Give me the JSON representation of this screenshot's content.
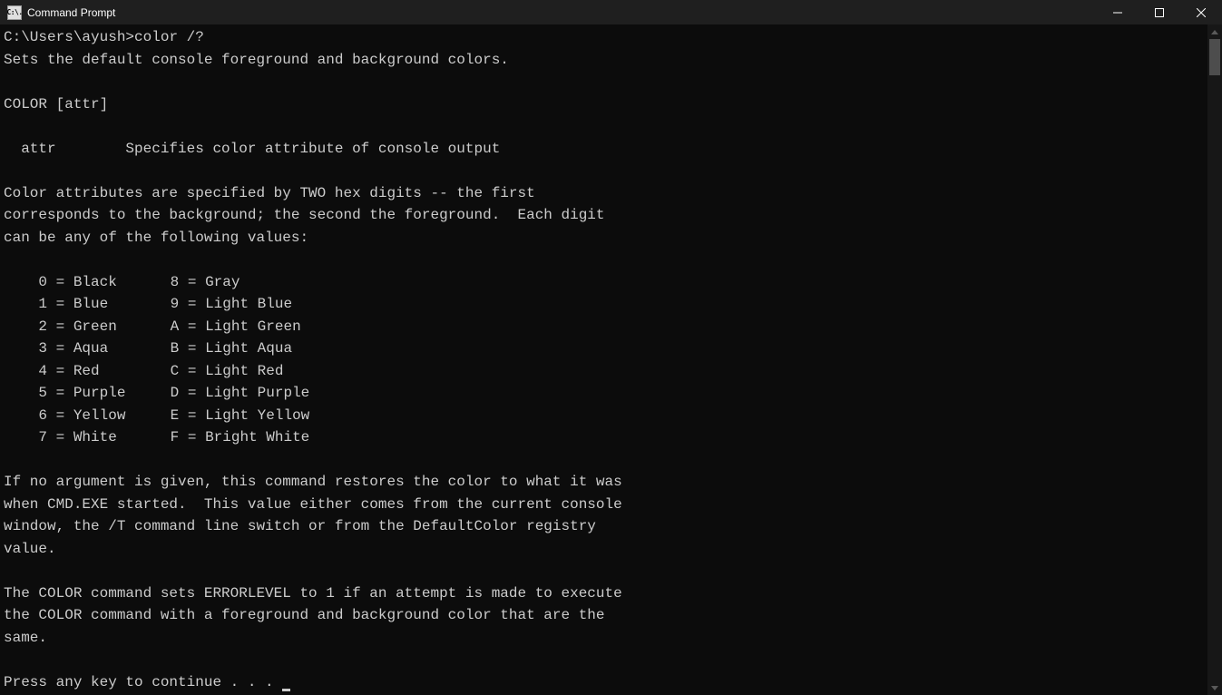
{
  "window": {
    "title": "Command Prompt",
    "icon_label": "C:\\."
  },
  "console": {
    "prompt_path": "C:\\Users\\ayush>",
    "prompt_command": "color /?",
    "help_intro": "Sets the default console foreground and background colors.",
    "syntax": "COLOR [attr]",
    "attr_label": "  attr",
    "attr_desc": "Specifies color attribute of console output",
    "explain_l1": "Color attributes are specified by TWO hex digits -- the first",
    "explain_l2": "corresponds to the background; the second the foreground.  Each digit",
    "explain_l3": "can be any of the following values:",
    "colors": {
      "c0": {
        "left_code": "0",
        "left_name": "Black",
        "right_code": "8",
        "right_name": "Gray"
      },
      "c1": {
        "left_code": "1",
        "left_name": "Blue",
        "right_code": "9",
        "right_name": "Light Blue"
      },
      "c2": {
        "left_code": "2",
        "left_name": "Green",
        "right_code": "A",
        "right_name": "Light Green"
      },
      "c3": {
        "left_code": "3",
        "left_name": "Aqua",
        "right_code": "B",
        "right_name": "Light Aqua"
      },
      "c4": {
        "left_code": "4",
        "left_name": "Red",
        "right_code": "C",
        "right_name": "Light Red"
      },
      "c5": {
        "left_code": "5",
        "left_name": "Purple",
        "right_code": "D",
        "right_name": "Light Purple"
      },
      "c6": {
        "left_code": "6",
        "left_name": "Yellow",
        "right_code": "E",
        "right_name": "Light Yellow"
      },
      "c7": {
        "left_code": "7",
        "left_name": "White",
        "right_code": "F",
        "right_name": "Bright White"
      }
    },
    "noarg_l1": "If no argument is given, this command restores the color to what it was",
    "noarg_l2": "when CMD.EXE started.  This value either comes from the current console",
    "noarg_l3": "window, the /T command line switch or from the DefaultColor registry",
    "noarg_l4": "value.",
    "errlvl_l1": "The COLOR command sets ERRORLEVEL to 1 if an attempt is made to execute",
    "errlvl_l2": "the COLOR command with a foreground and background color that are the",
    "errlvl_l3": "same.",
    "press_key": "Press any key to continue . . . "
  }
}
